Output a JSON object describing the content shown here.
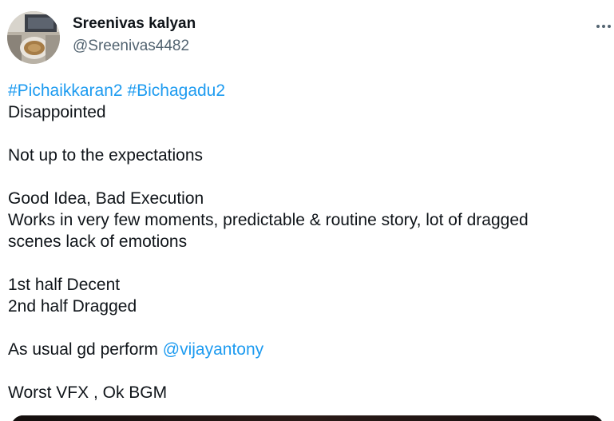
{
  "author": {
    "name": "Sreenivas kalyan",
    "handle": "@Sreenivas4482"
  },
  "icons": {
    "more": "more-dots-icon",
    "avatar": "profile-photo"
  },
  "colors": {
    "link": "#1d9bf0",
    "text": "#0f1419",
    "muted": "#536471"
  },
  "tweet": {
    "hashtag1": "#Pichaikkaran2",
    "hashtag2": "#Bichagadu2",
    "line_disappointed": "Disappointed",
    "line_expectations": "Not up to the expectations",
    "line_good_idea": "Good Idea, Bad Execution",
    "line_works": "Works in very few moments, predictable & routine story, lot of dragged",
    "line_scenes": "scenes lack of emotions",
    "line_first_half": "1st half Decent",
    "line_second_half": "2nd half Dragged",
    "line_usual_prefix": "As usual gd perform ",
    "mention": "@vijayantony",
    "line_vfx": "Worst VFX , Ok BGM"
  }
}
